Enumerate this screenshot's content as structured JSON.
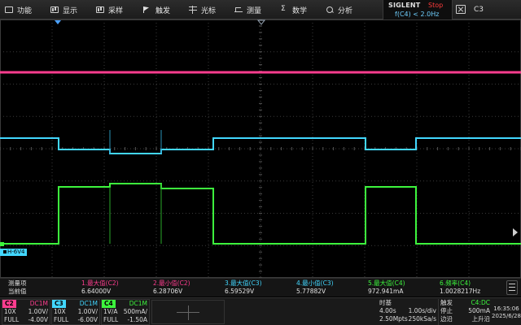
{
  "menu": [
    {
      "label": "功能",
      "icon": "function-icon"
    },
    {
      "label": "显示",
      "icon": "display-icon"
    },
    {
      "label": "采样",
      "icon": "acquire-icon"
    },
    {
      "label": "触发",
      "icon": "trigger-icon"
    },
    {
      "label": "光标",
      "icon": "cursor-icon"
    },
    {
      "label": "测量",
      "icon": "measure-icon"
    },
    {
      "label": "数学",
      "icon": "math-icon"
    },
    {
      "label": "分析",
      "icon": "analysis-icon"
    }
  ],
  "status": {
    "brand": "SIGLENT",
    "run_state": "Stop",
    "frequency": "f(C4) < 2.0Hz",
    "channel_select": "C3"
  },
  "channel_tag": "H-6V4",
  "colors": {
    "c2": "#ff3d8f",
    "c3": "#42d7ff",
    "c4": "#3df53d",
    "grid": "#3a3a3a",
    "axis_marker": "#4aa0ff"
  },
  "measurements": {
    "row_header": "测量项",
    "row_value": "当前值",
    "items": [
      {
        "name": "1.最大值(C2)",
        "value": "6.64000V",
        "color": "#ff3d8f"
      },
      {
        "name": "2.最小值(C2)",
        "value": "6.28706V",
        "color": "#ff3d8f"
      },
      {
        "name": "3.最大值(C3)",
        "value": "6.59529V",
        "color": "#42d7ff"
      },
      {
        "name": "4.最小值(C3)",
        "value": "5.77882V",
        "color": "#42d7ff"
      },
      {
        "name": "5.最大值(C4)",
        "value": "972.941mA",
        "color": "#3df53d"
      },
      {
        "name": "6.频率(C4)",
        "value": "1.0028217Hz",
        "color": "#3df53d"
      }
    ]
  },
  "channels": [
    {
      "name": "C2",
      "coupling": "DC1M",
      "probe": "10X",
      "scale": "1.00V/",
      "bw": "FULL",
      "offset": "-4.00V",
      "color": "#ff3d8f"
    },
    {
      "name": "C3",
      "coupling": "DC1M",
      "probe": "10X",
      "scale": "1.00V/",
      "bw": "FULL",
      "offset": "-6.00V",
      "color": "#42d7ff"
    },
    {
      "name": "C4",
      "coupling": "DC1M",
      "probe": "1V/A",
      "scale": "500mA/",
      "bw": "FULL",
      "offset": "-1.50A",
      "color": "#3df53d"
    }
  ],
  "timebase": {
    "title": "时基",
    "delay": "4.00s",
    "scale": "1.00s/div",
    "mpts": "2.50Mpts",
    "rate": "250kSa/s"
  },
  "trigger": {
    "title": "触发",
    "source": "C4:DC",
    "mode": "停止",
    "level": "500mA",
    "type": "边沿",
    "slope": "上升沿"
  },
  "clock": {
    "time": "16:35:06",
    "date": "2025/6/28"
  }
}
